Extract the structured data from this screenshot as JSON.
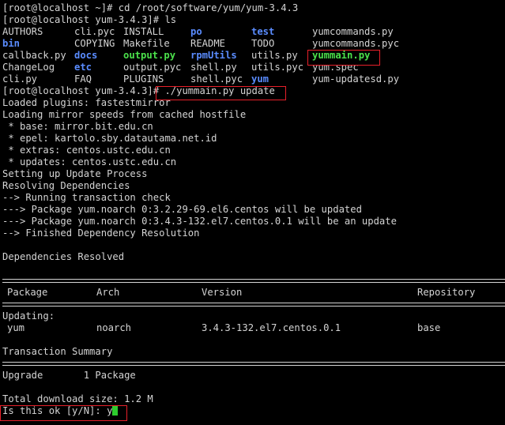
{
  "terminal": {
    "lines": {
      "l01": "[root@localhost ~]# cd /root/software/yum/yum-3.4.3",
      "l02": "[root@localhost yum-3.4.3]# ls",
      "l08": "[root@localhost yum-3.4.3]# ./yummain.py update",
      "l09": "Loaded plugins: fastestmirror",
      "l10": "Loading mirror speeds from cached hostfile",
      "l11": " * base: mirror.bit.edu.cn",
      "l12": " * epel: kartolo.sby.datautama.net.id",
      "l13": " * extras: centos.ustc.edu.cn",
      "l14": " * updates: centos.ustc.edu.cn",
      "l15": "Setting up Update Process",
      "l16": "Resolving Dependencies",
      "l17": "--> Running transaction check",
      "l18": "---> Package yum.noarch 0:3.2.29-69.el6.centos will be updated",
      "l19": "---> Package yum.noarch 0:3.4.3-132.el7.centos.0.1 will be an update",
      "l20": "--> Finished Dependency Resolution",
      "l22": "Dependencies Resolved",
      "l27": "Updating:",
      "l30": "Transaction Summary",
      "l32": "Upgrade       1 Package",
      "l34": "Total download size: 1.2 M",
      "prompt_question": "Is this ok [y/N]: ",
      "prompt_answer": "y"
    },
    "ls_output": [
      [
        "AUTHORS",
        "cli.pyc",
        "INSTALL",
        "po",
        "test",
        "yumcommands.py"
      ],
      [
        "bin",
        "COPYING",
        "Makefile",
        "README",
        "TODO",
        "yumcommands.pyc"
      ],
      [
        "callback.py",
        "docs",
        "output.py",
        "rpmUtils",
        "utils.py",
        "yummain.py"
      ],
      [
        "ChangeLog",
        "etc",
        "output.pyc",
        "shell.py",
        "utils.pyc",
        "yum.spec"
      ],
      [
        "cli.py",
        "FAQ",
        "PLUGINS",
        "shell.pyc",
        "yum",
        "yum-updatesd.py"
      ]
    ],
    "table": {
      "headers": [
        "Package",
        "Arch",
        "Version",
        "Repository"
      ],
      "row": [
        "yum",
        "noarch",
        "3.4.3-132.el7.centos.0.1",
        "base"
      ]
    },
    "colors": {
      "background": "#000000",
      "foreground": "#d4d4d4",
      "directory": "#5a8cff",
      "executable": "#4be04b",
      "highlight_box": "#e8202a",
      "cursor": "#2ecc2e"
    }
  }
}
